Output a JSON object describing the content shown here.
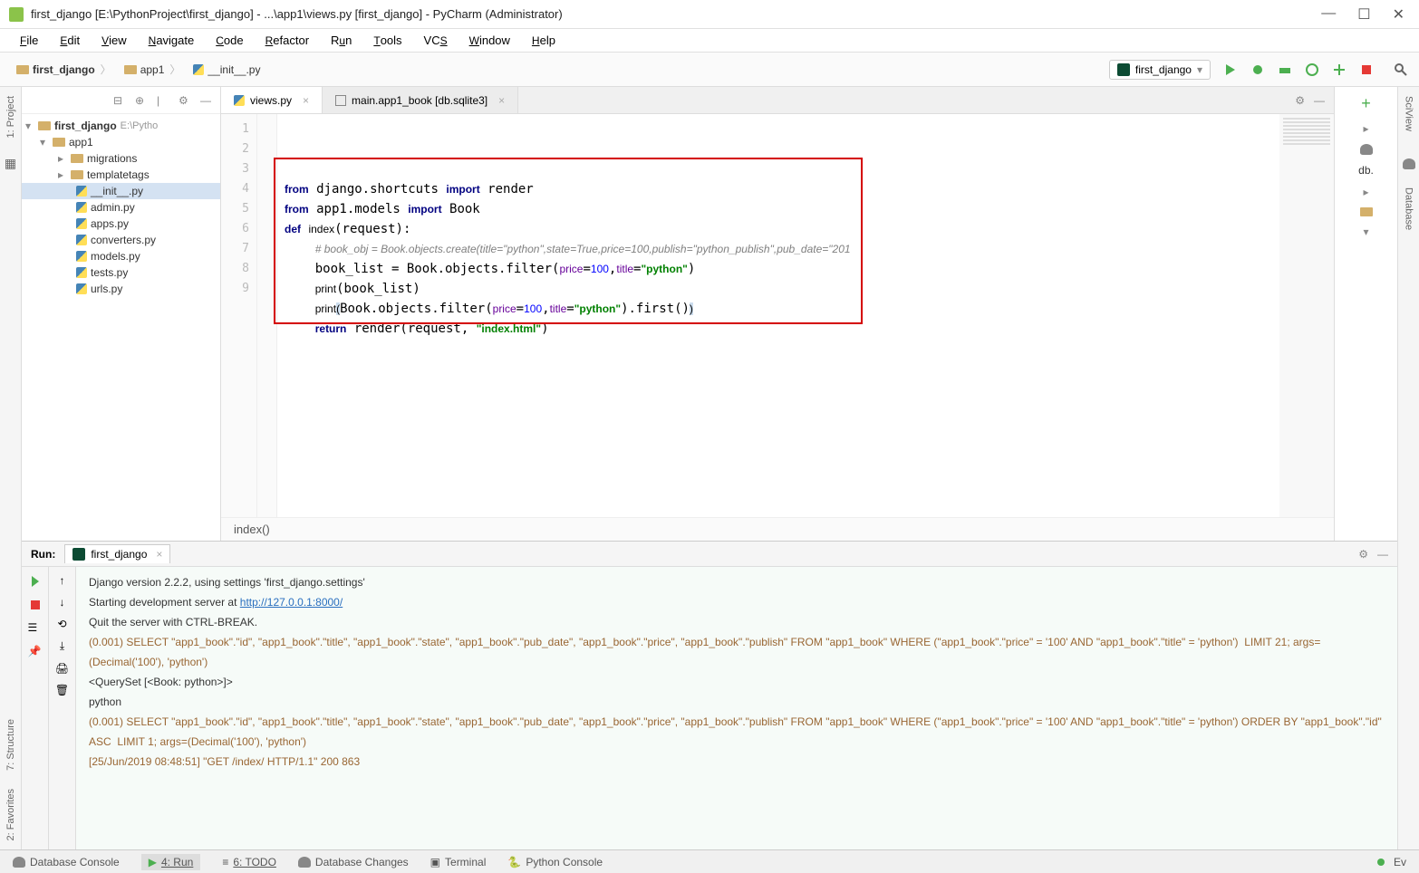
{
  "title": "first_django [E:\\PythonProject\\first_django] - ...\\app1\\views.py [first_django] - PyCharm (Administrator)",
  "menus": [
    "File",
    "Edit",
    "View",
    "Navigate",
    "Code",
    "Refactor",
    "Run",
    "Tools",
    "VCS",
    "Window",
    "Help"
  ],
  "breadcrumbs": [
    "first_django",
    "app1",
    "__init__.py"
  ],
  "run_config": "first_django",
  "tabs": [
    {
      "label": "views.py",
      "active": true
    },
    {
      "label": "main.app1_book [db.sqlite3]",
      "active": false
    }
  ],
  "tree": {
    "root": "first_django",
    "root_path": "E:\\Pytho",
    "items": [
      {
        "l": 1,
        "t": "app1",
        "exp": true,
        "kind": "dir"
      },
      {
        "l": 2,
        "t": "migrations",
        "exp": false,
        "kind": "dir"
      },
      {
        "l": 2,
        "t": "templatetags",
        "exp": false,
        "kind": "dir"
      },
      {
        "l": 3,
        "t": "__init__.py",
        "kind": "py",
        "sel": true
      },
      {
        "l": 3,
        "t": "admin.py",
        "kind": "py"
      },
      {
        "l": 3,
        "t": "apps.py",
        "kind": "py"
      },
      {
        "l": 3,
        "t": "converters.py",
        "kind": "py"
      },
      {
        "l": 3,
        "t": "models.py",
        "kind": "py"
      },
      {
        "l": 3,
        "t": "tests.py",
        "kind": "py"
      },
      {
        "l": 3,
        "t": "urls.py",
        "kind": "py"
      }
    ]
  },
  "line_count": 9,
  "breadcrumb_bottom": "index()",
  "run_label": "Run:",
  "run_tab": "first_django",
  "console_lines": [
    {
      "t": "Django version 2.2.2, using settings 'first_django.settings'"
    },
    {
      "t": "Starting development server at ",
      "link": "http://127.0.0.1:8000/"
    },
    {
      "t": "Quit the server with CTRL-BREAK."
    },
    {
      "cls": "sql",
      "t": "(0.001) SELECT \"app1_book\".\"id\", \"app1_book\".\"title\", \"app1_book\".\"state\", \"app1_book\".\"pub_date\", \"app1_book\".\"price\", \"app1_book\".\"publish\" FROM \"app1_book\" WHERE (\"app1_book\".\"price\" = '100' AND \"app1_book\".\"title\" = 'python')  LIMIT 21; args=(Decimal('100'), 'python')"
    },
    {
      "t": "<QuerySet [<Book: python>]>"
    },
    {
      "t": "python"
    },
    {
      "cls": "sql",
      "t": "(0.001) SELECT \"app1_book\".\"id\", \"app1_book\".\"title\", \"app1_book\".\"state\", \"app1_book\".\"pub_date\", \"app1_book\".\"price\", \"app1_book\".\"publish\" FROM \"app1_book\" WHERE (\"app1_book\".\"price\" = '100' AND \"app1_book\".\"title\" = 'python') ORDER BY \"app1_book\".\"id\" ASC  LIMIT 1; args=(Decimal('100'), 'python')"
    },
    {
      "cls": "sql",
      "t": "[25/Jun/2019 08:48:51] \"GET /index/ HTTP/1.1\" 200 863"
    }
  ],
  "statusbar": {
    "items": [
      "Database Console",
      "4: Run",
      "6: TODO",
      "Database Changes",
      "Terminal",
      "Python Console"
    ],
    "ev": "Ev"
  },
  "side_labels": {
    "project": "1: Project",
    "structure": "7: Structure",
    "favorites": "2: Favorites",
    "sciview": "SciView",
    "database": "Database"
  }
}
